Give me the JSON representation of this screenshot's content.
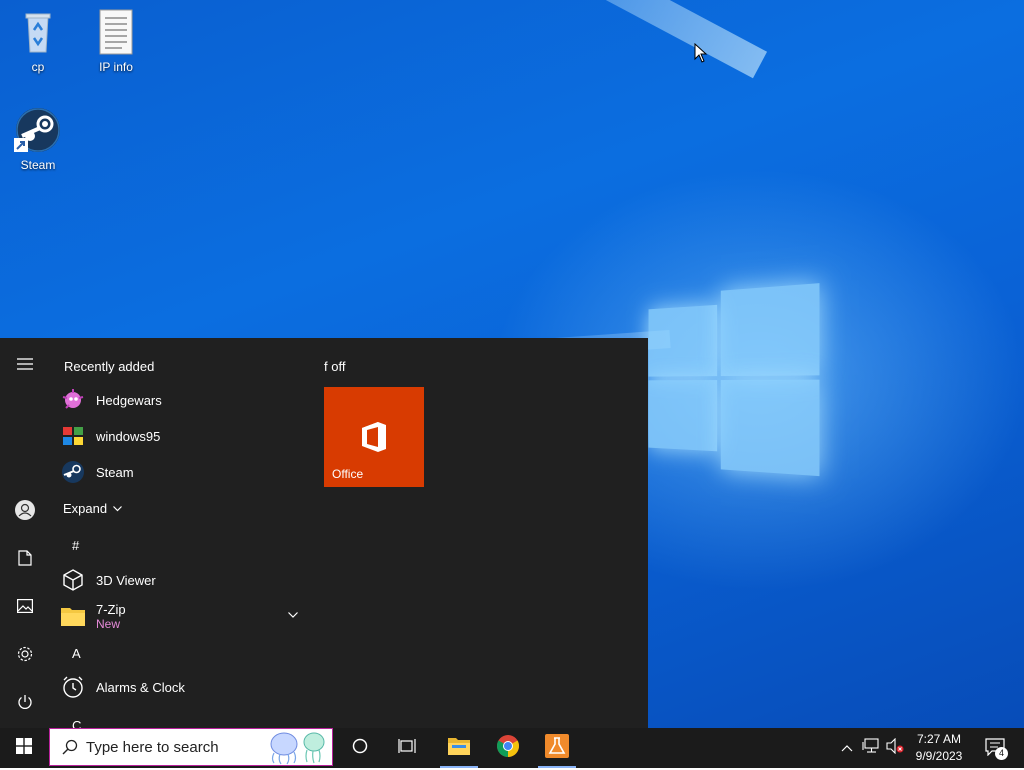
{
  "desktop": {
    "icons": [
      {
        "label": "cp",
        "icon": "recycle-bin-icon"
      },
      {
        "label": "IP info",
        "icon": "text-document-icon"
      },
      {
        "label": "Steam",
        "icon": "steam-icon"
      }
    ]
  },
  "start_menu": {
    "recently_added_label": "Recently added",
    "recent_apps": [
      {
        "label": "Hedgewars",
        "icon": "hedgewars-icon"
      },
      {
        "label": "windows95",
        "icon": "windows95-icon"
      },
      {
        "label": "Steam",
        "icon": "steam-icon"
      }
    ],
    "expand_label": "Expand",
    "sections": [
      {
        "letter": "#",
        "apps": [
          {
            "label": "3D Viewer",
            "icon": "3d-viewer-icon"
          },
          {
            "label": "7-Zip",
            "sub": "New",
            "icon": "folder-icon"
          }
        ]
      },
      {
        "letter": "A",
        "apps": [
          {
            "label": "Alarms & Clock",
            "icon": "alarm-clock-icon"
          }
        ]
      },
      {
        "letter": "C",
        "apps": []
      }
    ],
    "tile_group": "f off",
    "tiles": [
      {
        "label": "Office",
        "color": "#d83b01",
        "icon": "office-icon"
      }
    ]
  },
  "taskbar": {
    "search_placeholder": "Type here to search",
    "pinned": [
      "cortana-icon",
      "task-view-icon",
      "file-explorer-icon",
      "chrome-icon",
      "flask-app-icon"
    ],
    "tray": [
      "chevron-up-icon",
      "network-icon",
      "volume-muted-icon"
    ],
    "time": "7:27 AM",
    "date": "9/9/2023",
    "notifications_count": "4"
  },
  "colors": {
    "accent": "#d83b01",
    "search_border": "#b9229c",
    "sub_label": "#e58ad8"
  }
}
